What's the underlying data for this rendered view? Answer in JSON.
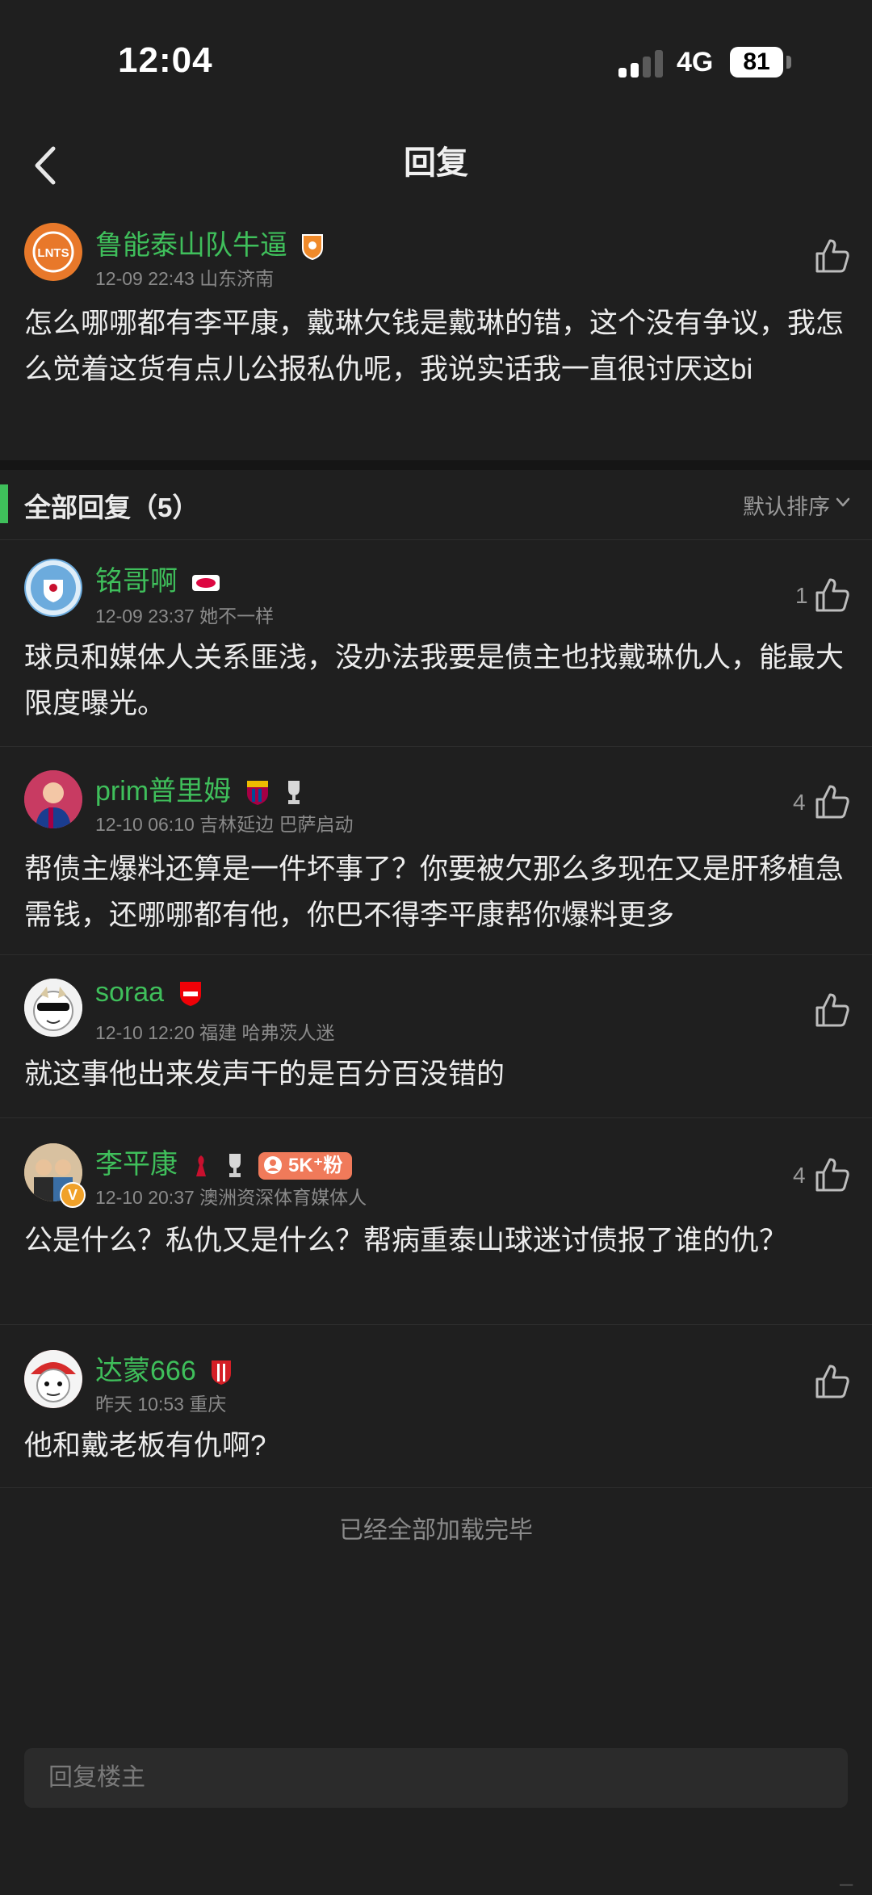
{
  "status": {
    "time": "12:04",
    "network": "4G",
    "battery": "81"
  },
  "header": {
    "title": "回复"
  },
  "main_comment": {
    "username": "鲁能泰山队牛逼",
    "meta": "12-09 22:43 山东济南",
    "text": "怎么哪哪都有李平康，戴琳欠钱是戴琳的错，这个没有争议，我怎么觉着这货有点儿公报私仇呢，我说实话我一直很讨厌这bi",
    "avatar_text": "LNTS"
  },
  "section": {
    "title": "全部回复（5）",
    "sort_label": "默认排序"
  },
  "replies": [
    {
      "username": "铭哥啊",
      "meta": "12-09 23:37 她不一样",
      "text": "球员和媒体人关系匪浅，没办法我要是债主也找戴琳仇人，能最大限度曝光。",
      "likes": "1"
    },
    {
      "username": "prim普里姆",
      "meta": "12-10 06:10 吉林延边 巴萨启动",
      "text": "帮债主爆料还算是一件坏事了？你要被欠那么多现在又是肝移植急需钱，还哪哪都有他，你巴不得李平康帮你爆料更多",
      "likes": "4"
    },
    {
      "username": "soraa",
      "meta": "12-10 12:20 福建 哈弗茨人迷",
      "text": "就这事他出来发声干的是百分百没错的",
      "likes": ""
    },
    {
      "username": "李平康",
      "meta": "12-10 20:37 澳洲资深体育媒体人",
      "text": "公是什么？私仇又是什么？帮病重泰山球迷讨债报了谁的仇？",
      "likes": "4",
      "fans_badge": "5K⁺粉",
      "verified": "V"
    },
    {
      "username": "达蒙666",
      "meta": "昨天 10:53 重庆",
      "text": "他和戴老板有仇啊?",
      "likes": ""
    }
  ],
  "footer": {
    "all_loaded": "已经全部加载完毕"
  },
  "reply_input": {
    "placeholder": "回复楼主"
  },
  "colors": {
    "accent": "#3fbf5b",
    "background": "#1f1f1f"
  }
}
